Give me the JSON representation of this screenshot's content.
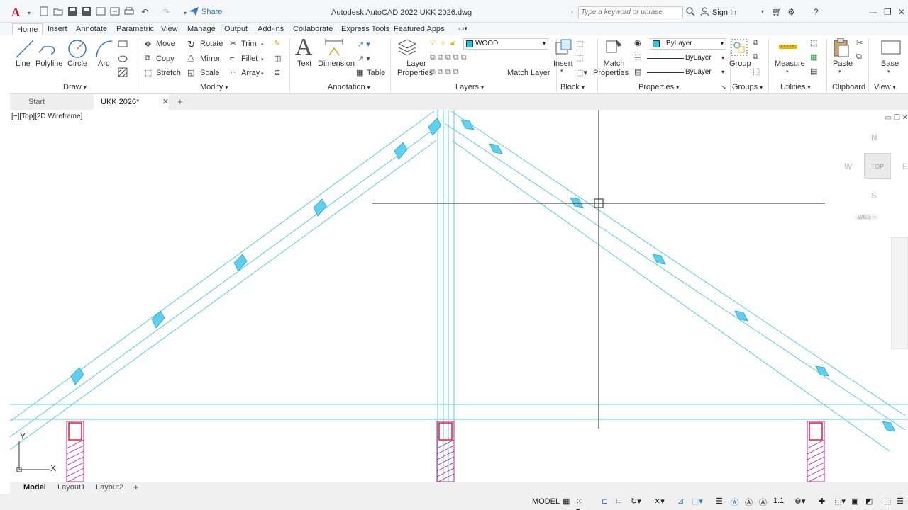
{
  "app": {
    "logo": "A",
    "title": "Autodesk AutoCAD 2022   UKK 2026.dwg",
    "share_label": "Share",
    "search_placeholder": "Type a keyword or phrase",
    "signin_label": "Sign In"
  },
  "ribbon_tabs": [
    "Home",
    "Insert",
    "Annotate",
    "Parametric",
    "View",
    "Manage",
    "Output",
    "Add-ins",
    "Collaborate",
    "Express Tools",
    "Featured Apps"
  ],
  "draw": {
    "title": "Draw",
    "line": "Line",
    "polyline": "Polyline",
    "circle": "Circle",
    "arc": "Arc"
  },
  "modify": {
    "title": "Modify",
    "move": "Move",
    "rotate": "Rotate",
    "trim": "Trim",
    "copy": "Copy",
    "mirror": "Mirror",
    "fillet": "Fillet",
    "stretch": "Stretch",
    "scale": "Scale",
    "array": "Array"
  },
  "annotation": {
    "title": "Annotation",
    "text": "Text",
    "dimension": "Dimension",
    "table": "Table"
  },
  "layers": {
    "title": "Layers",
    "layer_properties_1": "Layer",
    "layer_properties_2": "Properties",
    "current_layer": "WOOD",
    "match_layer": "Match Layer"
  },
  "block": {
    "title": "Block",
    "insert": "Insert"
  },
  "properties": {
    "title": "Properties",
    "match_1": "Match",
    "match_2": "Properties",
    "color": "ByLayer",
    "linetype": "ByLayer",
    "lineweight": "ByLayer"
  },
  "groups": {
    "title": "Groups",
    "group": "Group"
  },
  "utilities": {
    "title": "Utilities",
    "measure": "Measure"
  },
  "clipboard": {
    "title": "Clipboard",
    "paste": "Paste"
  },
  "view": {
    "title": "View",
    "base": "Base"
  },
  "doc_tabs": {
    "start": "Start",
    "current": "UKK 2026*"
  },
  "viewport": {
    "label": "[−][Top][2D Wireframe]",
    "north": "N",
    "south": "S",
    "east": "E",
    "west": "W",
    "top": "TOP",
    "wcs": "WCS –",
    "ucs_x": "X",
    "ucs_y": "Y"
  },
  "layout_tabs": [
    "Model",
    "Layout1",
    "Layout2"
  ],
  "status": {
    "space": "MODEL",
    "scale": "1:1"
  },
  "colors": {
    "wood": "#5bc8e8",
    "wood_fill": "#5ed0ef",
    "column": "#c8209c",
    "rebar": "#e0222a",
    "crosshair": "#222222",
    "accent": "#2c7bd1"
  }
}
